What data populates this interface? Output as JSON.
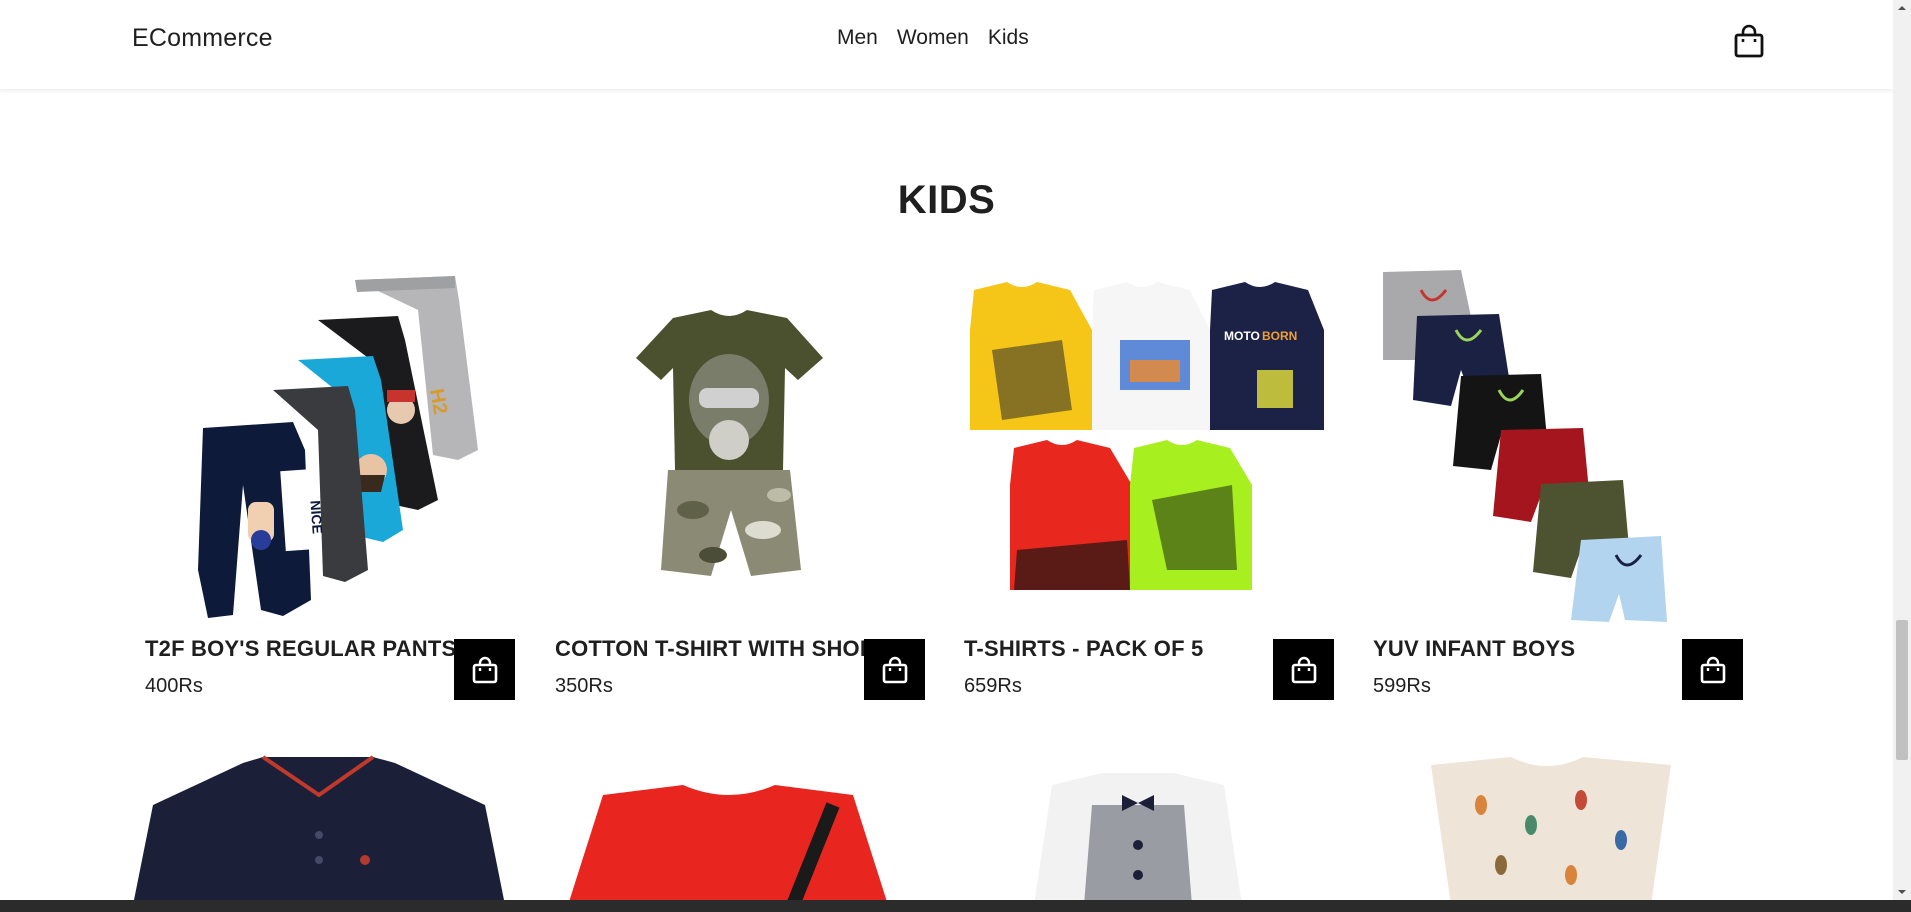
{
  "header": {
    "brand": "ECommerce",
    "nav": [
      "Men",
      "Women",
      "Kids"
    ],
    "cart_icon": "shopping-bag-icon"
  },
  "section": {
    "title": "KIDS"
  },
  "products": [
    {
      "name": "T2F BOY'S REGULAR PANTS",
      "price": "400Rs"
    },
    {
      "name": "COTTON T-SHIRT WITH SHORTS",
      "price": "350Rs"
    },
    {
      "name": "T-SHIRTS - PACK OF 5",
      "price": "659Rs"
    },
    {
      "name": "YUV INFANT BOYS",
      "price": "599Rs"
    }
  ],
  "colors": {
    "accent": "#000000",
    "text": "#1f1f1f",
    "background": "#ffffff"
  }
}
